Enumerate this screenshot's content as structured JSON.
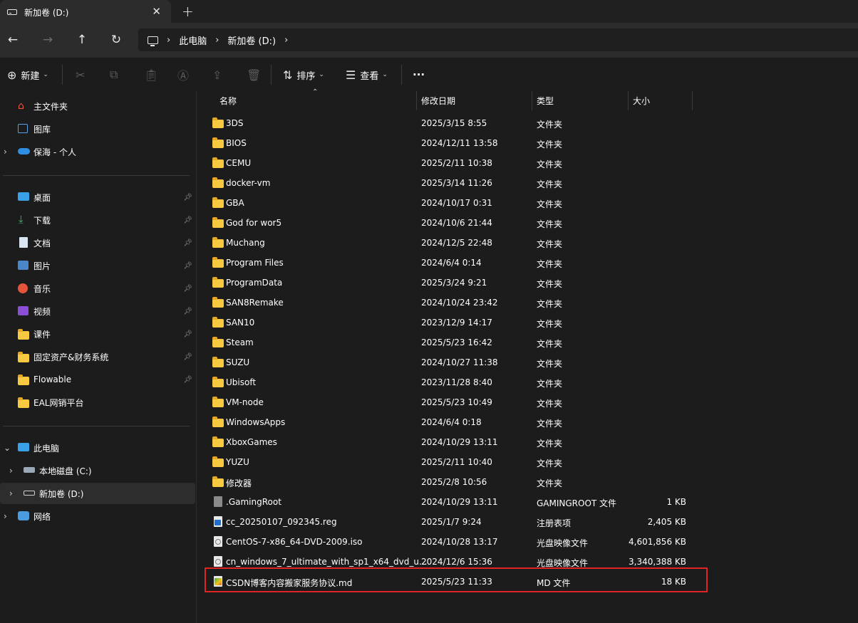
{
  "window": {
    "tab_title": "新加卷 (D:)",
    "tab_close": "✕",
    "new_tab": "+"
  },
  "nav": {
    "back": "←",
    "forward": "→",
    "up": "↑",
    "refresh": "↻",
    "breadcrumb": [
      "此电脑",
      "新加卷 (D:)"
    ],
    "sep": "›"
  },
  "toolbar": {
    "new_label": "新建",
    "sort_label": "排序",
    "view_label": "查看",
    "more_label": "···"
  },
  "sidebar": {
    "quick": [
      {
        "label": "主文件夹",
        "icon": "home-icon"
      },
      {
        "label": "图库",
        "icon": "gallery-icon"
      },
      {
        "label": "保海 - 个人",
        "icon": "onedrive-icon"
      }
    ],
    "pinned": [
      {
        "label": "桌面",
        "icon": "desktop-icon"
      },
      {
        "label": "下载",
        "icon": "download-icon"
      },
      {
        "label": "文档",
        "icon": "documents-icon"
      },
      {
        "label": "图片",
        "icon": "pictures-icon"
      },
      {
        "label": "音乐",
        "icon": "music-icon"
      },
      {
        "label": "视频",
        "icon": "videos-icon"
      },
      {
        "label": "课件",
        "icon": "folder-icon"
      },
      {
        "label": "固定资产&财务系统",
        "icon": "folder-icon"
      },
      {
        "label": "Flowable",
        "icon": "folder-icon"
      },
      {
        "label": "EAL网销平台",
        "icon": "folder-icon"
      }
    ],
    "tree": [
      {
        "label": "此电脑",
        "icon": "pc-icon"
      },
      {
        "label": "本地磁盘 (C:)",
        "icon": "drive-icon"
      },
      {
        "label": "新加卷 (D:)",
        "icon": "drive-icon"
      },
      {
        "label": "网络",
        "icon": "network-icon"
      }
    ]
  },
  "columns": {
    "name": "名称",
    "date": "修改日期",
    "type": "类型",
    "size": "大小"
  },
  "files": [
    {
      "name": "3DS",
      "date": "2025/3/15 8:55",
      "type": "文件夹",
      "size": "",
      "kind": "folder"
    },
    {
      "name": "BIOS",
      "date": "2024/12/11 13:58",
      "type": "文件夹",
      "size": "",
      "kind": "folder"
    },
    {
      "name": "CEMU",
      "date": "2025/2/11 10:38",
      "type": "文件夹",
      "size": "",
      "kind": "folder"
    },
    {
      "name": "docker-vm",
      "date": "2025/3/14 11:26",
      "type": "文件夹",
      "size": "",
      "kind": "folder"
    },
    {
      "name": "GBA",
      "date": "2024/10/17 0:31",
      "type": "文件夹",
      "size": "",
      "kind": "folder"
    },
    {
      "name": "God for wor5",
      "date": "2024/10/6 21:44",
      "type": "文件夹",
      "size": "",
      "kind": "folder"
    },
    {
      "name": "Muchang",
      "date": "2024/12/5 22:48",
      "type": "文件夹",
      "size": "",
      "kind": "folder"
    },
    {
      "name": "Program Files",
      "date": "2024/6/4 0:14",
      "type": "文件夹",
      "size": "",
      "kind": "folder"
    },
    {
      "name": "ProgramData",
      "date": "2025/3/24 9:21",
      "type": "文件夹",
      "size": "",
      "kind": "folder"
    },
    {
      "name": "SAN8Remake",
      "date": "2024/10/24 23:42",
      "type": "文件夹",
      "size": "",
      "kind": "folder"
    },
    {
      "name": "SAN10",
      "date": "2023/12/9 14:17",
      "type": "文件夹",
      "size": "",
      "kind": "folder"
    },
    {
      "name": "Steam",
      "date": "2025/5/23 16:42",
      "type": "文件夹",
      "size": "",
      "kind": "folder"
    },
    {
      "name": "SUZU",
      "date": "2024/10/27 11:38",
      "type": "文件夹",
      "size": "",
      "kind": "folder"
    },
    {
      "name": "Ubisoft",
      "date": "2023/11/28 8:40",
      "type": "文件夹",
      "size": "",
      "kind": "folder"
    },
    {
      "name": "VM-node",
      "date": "2025/5/23 10:49",
      "type": "文件夹",
      "size": "",
      "kind": "folder"
    },
    {
      "name": "WindowsApps",
      "date": "2024/6/4 0:18",
      "type": "文件夹",
      "size": "",
      "kind": "folder"
    },
    {
      "name": "XboxGames",
      "date": "2024/10/29 13:11",
      "type": "文件夹",
      "size": "",
      "kind": "folder"
    },
    {
      "name": "YUZU",
      "date": "2025/2/11 10:40",
      "type": "文件夹",
      "size": "",
      "kind": "folder"
    },
    {
      "name": "修改器",
      "date": "2025/2/8 10:56",
      "type": "文件夹",
      "size": "",
      "kind": "folder"
    },
    {
      "name": ".GamingRoot",
      "date": "2024/10/29 13:11",
      "type": "GAMINGROOT 文件",
      "size": "1 KB",
      "kind": "generic-file"
    },
    {
      "name": "cc_20250107_092345.reg",
      "date": "2025/1/7 9:24",
      "type": "注册表项",
      "size": "2,405 KB",
      "kind": "reg-file"
    },
    {
      "name": "CentOS-7-x86_64-DVD-2009.iso",
      "date": "2024/10/28 13:17",
      "type": "光盘映像文件",
      "size": "4,601,856 KB",
      "kind": "iso-file"
    },
    {
      "name": "cn_windows_7_ultimate_with_sp1_x64_dvd_u...",
      "date": "2024/12/6 15:36",
      "type": "光盘映像文件",
      "size": "3,340,388 KB",
      "kind": "iso-file"
    },
    {
      "name": "CSDN博客内容搬家服务协议.md",
      "date": "2025/5/23 11:33",
      "type": "MD 文件",
      "size": "18 KB",
      "kind": "md-file"
    }
  ],
  "colors": {
    "highlight": "#e02424",
    "folder": "#f7c940",
    "background": "#1c1c1c"
  }
}
